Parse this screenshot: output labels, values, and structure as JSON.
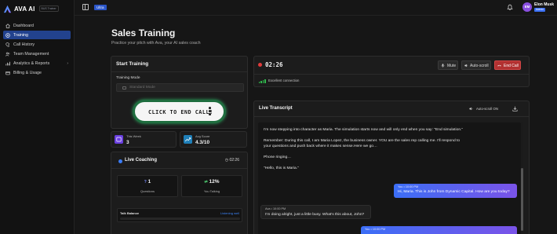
{
  "app": {
    "name": "AVA AI",
    "badge": "BUS Trainer",
    "tier_badge": "Ultra"
  },
  "sidebar": {
    "items": [
      {
        "label": "Dashboard",
        "icon": "home-icon"
      },
      {
        "label": "Training",
        "icon": "training-icon",
        "active": true
      },
      {
        "label": "Call History",
        "icon": "history-icon"
      },
      {
        "label": "Team Management",
        "icon": "team-icon"
      },
      {
        "label": "Analytics & Reports",
        "icon": "chart-icon",
        "has_caret": true
      },
      {
        "label": "Billing & Usage",
        "icon": "billing-icon"
      }
    ]
  },
  "user": {
    "initials": "EM",
    "name": "Elon Musk",
    "role": "Admin"
  },
  "page": {
    "title": "Sales Training",
    "subtitle": "Practice your pitch with Ava, your AI sales coach"
  },
  "start_training": {
    "title": "Start Training",
    "mode_label": "Training Mode",
    "mode_value": "Standard Mode",
    "end_call_cta": "CLICK TO END CALL!"
  },
  "stats": {
    "week": {
      "label": "This Week",
      "value": "3"
    },
    "score": {
      "label": "Avg Score",
      "value": "4.3/10"
    }
  },
  "coaching": {
    "title": "Live Coaching",
    "timer": "02:26",
    "questions": {
      "value": "1",
      "label": "Questions"
    },
    "talking": {
      "value": "12%",
      "label": "You Talking"
    },
    "talk_balance": {
      "label": "Talk Balance",
      "status": "Listening well"
    }
  },
  "call": {
    "timer": "02:26",
    "mute_label": "Mute",
    "autoscroll_label": "Auto-scroll",
    "end_label": "End Call",
    "connection": "Excellent connection"
  },
  "transcript": {
    "title": "Live Transcript",
    "autoscroll": "Auto-scroll ON",
    "ai_paragraphs": [
      "I'm now stepping into character as Maria. The simulation starts now and will only end when you say: \"End simulation.\"",
      "Remember: During this call, I am Maria Lopez, the business owner. YOU are the sales rep calling me. I'll respond to your questions and push back where it makes sense.Here we go…",
      "Phone ringing…",
      "\"Hello, this is Maria.\""
    ],
    "messages": [
      {
        "speaker": "You",
        "time": "10:00 PM",
        "text": "Hi, Maria. This is John from Dynamic Capital. How are you today?"
      },
      {
        "speaker": "Ava",
        "time": "10:00 PM",
        "text": "I'm doing alright, just a little busy. What's this about, John?"
      },
      {
        "speaker": "You",
        "time": "10:00 PM",
        "text": ""
      }
    ]
  },
  "colors": {
    "accent": "#2b56c9",
    "active_nav": "#22428e",
    "end_call": "#b23131",
    "signal": "#2fb84c"
  }
}
